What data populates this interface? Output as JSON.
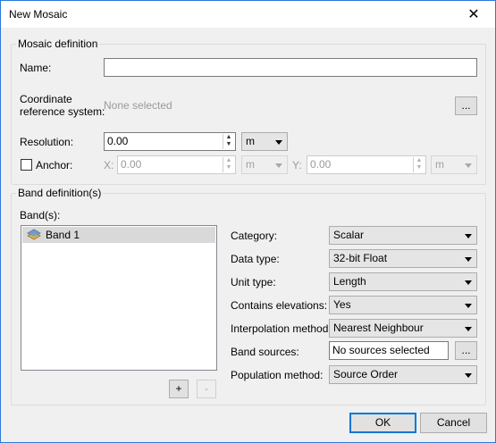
{
  "window": {
    "title": "New Mosaic",
    "close_glyph": "✕"
  },
  "mosaic_definition": {
    "legend": "Mosaic definition",
    "name_label": "Name:",
    "name_value": "",
    "crs_label_line1": "Coordinate",
    "crs_label_line2": "reference system:",
    "crs_value": "None selected",
    "crs_button": "...",
    "resolution_label": "Resolution:",
    "resolution_value": "0.00",
    "resolution_unit": "m",
    "anchor_label": "Anchor:",
    "anchor_checked": false,
    "x_label": "X:",
    "x_value": "0.00",
    "x_unit": "m",
    "y_label": "Y:",
    "y_value": "0.00",
    "y_unit": "m"
  },
  "band_definition": {
    "legend": "Band definition(s)",
    "bands_label": "Band(s):",
    "bands": [
      {
        "name": "Band 1",
        "icon": "raster-layer-icon"
      }
    ],
    "add_button": "+",
    "remove_button": "-",
    "category_label": "Category:",
    "category_value": "Scalar",
    "data_type_label": "Data type:",
    "data_type_value": "32-bit Float",
    "unit_type_label": "Unit type:",
    "unit_type_value": "Length",
    "contains_elevations_label": "Contains elevations:",
    "contains_elevations_value": "Yes",
    "interpolation_label": "Interpolation method:",
    "interpolation_value": "Nearest Neighbour",
    "band_sources_label": "Band sources:",
    "band_sources_value": "No sources selected",
    "band_sources_button": "...",
    "population_label": "Population method:",
    "population_value": "Source Order"
  },
  "footer": {
    "ok": "OK",
    "cancel": "Cancel"
  },
  "colors": {
    "accent": "#0078d7",
    "window_border": "#2b79d8",
    "selection": "#d9d9d9"
  }
}
